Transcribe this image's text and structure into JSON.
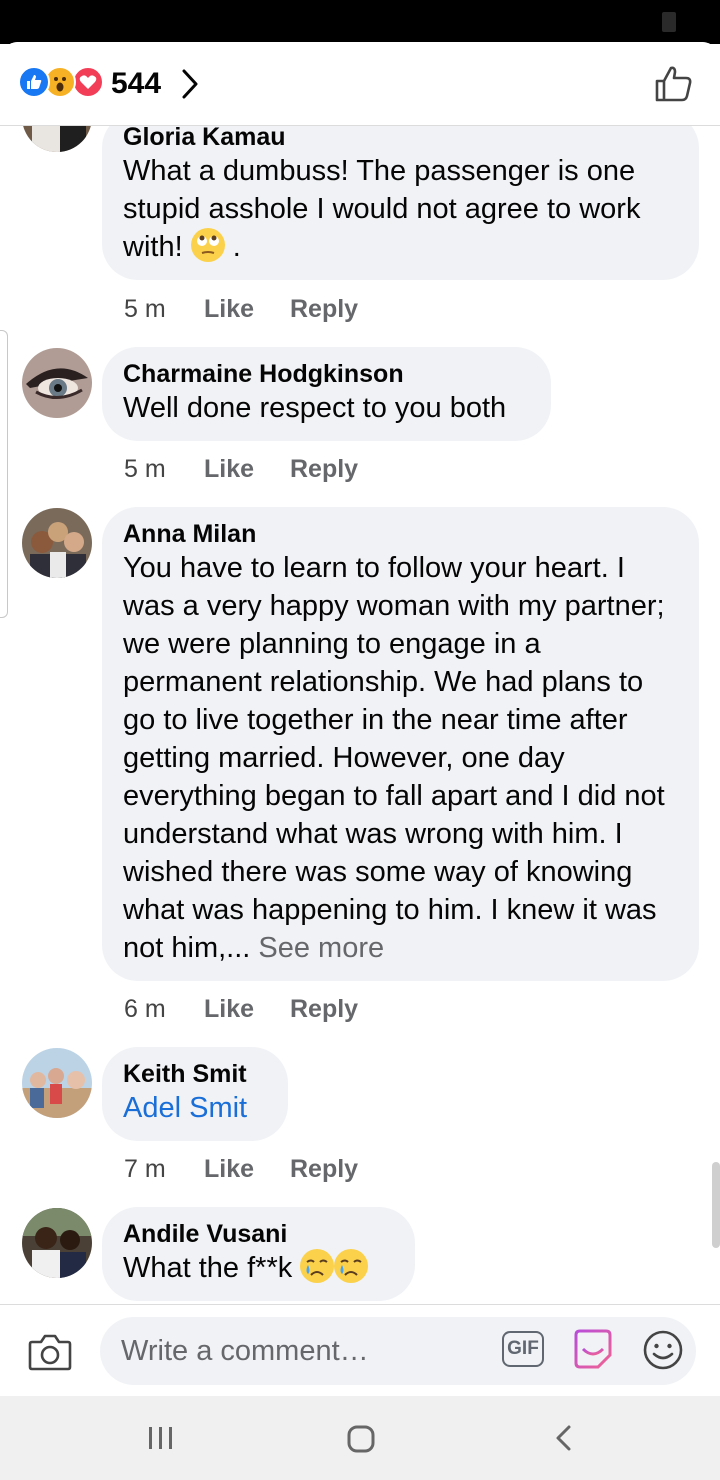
{
  "reactions": {
    "count": "544",
    "types": [
      "like-icon",
      "wow-icon",
      "love-icon"
    ]
  },
  "comments": [
    {
      "author": "Gloria Kamau",
      "text": "What a dumbuss! The passenger is one stupid asshole I would not agree to work with!",
      "text_suffix": " .",
      "time": "5 m",
      "like": "Like",
      "reply": "Reply"
    },
    {
      "author": "Charmaine Hodgkinson",
      "text": "Well done respect to you both",
      "time": "5 m",
      "like": "Like",
      "reply": "Reply"
    },
    {
      "author": "Anna Milan",
      "text": "You have to learn to follow your heart. I was a very happy woman with my partner; we were planning to engage in a permanent relationship. We had plans to go to live together in the near time after getting married. However, one day everything began to fall apart and I did not understand what was wrong with him. I wished there was some way of knowing what was happening to him. I knew it was not him,...",
      "see_more": "See more",
      "time": "6 m",
      "like": "Like",
      "reply": "Reply"
    },
    {
      "author": "Keith Smit",
      "mention": "Adel Smit",
      "time": "7 m",
      "like": "Like",
      "reply": "Reply"
    },
    {
      "author": "Andile Vusani",
      "text": "What the f**k",
      "emoji": [
        "crying-face-icon",
        "crying-face-icon"
      ]
    }
  ],
  "composer": {
    "placeholder": "Write a comment…",
    "gif_label": "GIF"
  },
  "colors": {
    "link": "#1a6ed8",
    "bubble": "#f0f2f5",
    "secondary_text": "#65676b",
    "like_blue": "#1877f2",
    "love_red": "#f33e58",
    "wow_yellow": "#f7b125"
  }
}
